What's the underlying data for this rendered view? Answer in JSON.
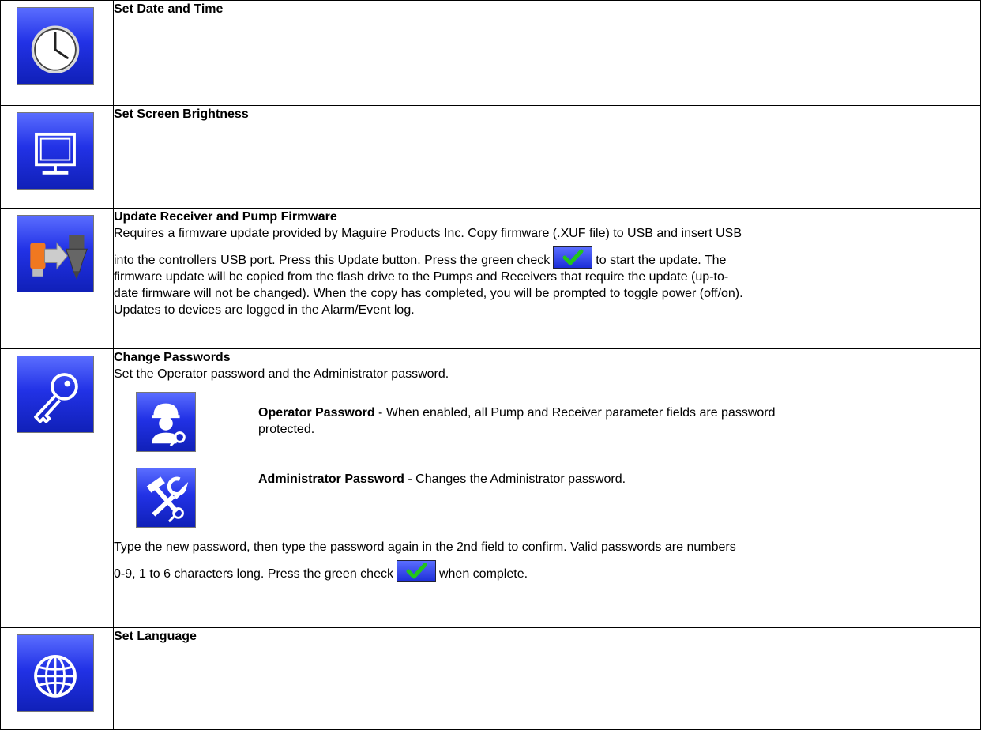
{
  "colors": {
    "button_blue": "#2232e6",
    "check_green": "#22c51a",
    "border": "#000000"
  },
  "rows": [
    {
      "icon": "clock-icon",
      "title": "Set Date and Time"
    },
    {
      "icon": "monitor-icon",
      "title": "Set Screen Brightness"
    },
    {
      "icon": "usb-firmware-icon",
      "title": "Update Receiver and Pump Firmware",
      "text_1": "Requires a firmware update provided by Maguire Products Inc.  Copy firmware (.XUF file) to USB and insert USB",
      "text_2a": "into the controllers USB port.  Press this Update button.  Press the green check",
      "text_2b": "to start the update.  The",
      "text_3": "firmware update will be copied from the flash drive to the Pumps and Receivers that require the update (up-to-",
      "text_4": "date firmware will not be changed).  When the copy has completed, you will be prompted to toggle power (off/on).",
      "text_5": "Updates to devices are logged in the Alarm/Event log."
    },
    {
      "icon": "key-icon",
      "title": "Change Passwords",
      "intro": "Set the Operator password and the Administrator password.",
      "operator": {
        "icon": "operator-key-icon",
        "label": "Operator Password",
        "desc": " - When enabled, all Pump and Receiver parameter fields are password protected."
      },
      "administrator": {
        "icon": "admin-tools-key-icon",
        "label": "Administrator Password",
        "desc": " - Changes the Administrator password."
      },
      "outro_1": "Type the new password, then type the password again in the 2nd field to confirm.  Valid passwords are numbers",
      "outro_2a": "0-9, 1 to 6 characters long.  Press the green check",
      "outro_2b": "when complete."
    },
    {
      "icon": "globe-icon",
      "title": "Set Language"
    }
  ]
}
